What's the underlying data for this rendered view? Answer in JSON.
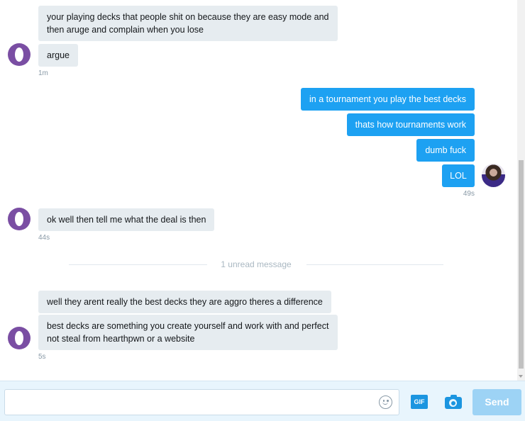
{
  "messages": [
    {
      "text": "your playing decks that people shit on because they are easy mode and then aruge and complain when you lose"
    },
    {
      "text": "argue",
      "time": "1m"
    },
    {
      "text": "in a tournament you play the best decks"
    },
    {
      "text": "thats how tournaments work"
    },
    {
      "text": "dumb fuck"
    },
    {
      "text": "LOL",
      "time": "49s"
    },
    {
      "text": "ok well then tell me what the deal is then",
      "time": "44s"
    },
    {
      "text": "well they arent really the best decks they are aggro theres a difference"
    },
    {
      "text": "best decks are something you create yourself and work with and perfect not steal from hearthpwn or a website",
      "time": "5s"
    }
  ],
  "divider": {
    "label": "1 unread message"
  },
  "composer": {
    "input_value": "",
    "gif_label": "GIF",
    "send_label": "Send"
  },
  "colors": {
    "incoming_bubble": "#e6ecf0",
    "outgoing_bubble": "#1da1f2",
    "send_button": "#9dd3f5",
    "accent": "#1b95e0"
  },
  "icons": [
    "emoji-icon",
    "gif-icon",
    "camera-icon"
  ]
}
